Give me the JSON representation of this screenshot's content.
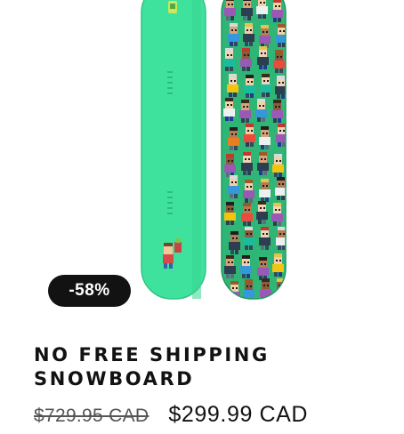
{
  "product": {
    "title": "No Free Shipping Snowboard",
    "sale_badge": "-58%",
    "price_compare": "$729.95 CAD",
    "price_sale": "$299.99 CAD",
    "image_alt": "Snowboard top and bottom view"
  },
  "colors": {
    "board_top": "#3ee59b",
    "board_bottom": "#2bb872",
    "badge_bg": "#121212",
    "text": "#121212"
  }
}
